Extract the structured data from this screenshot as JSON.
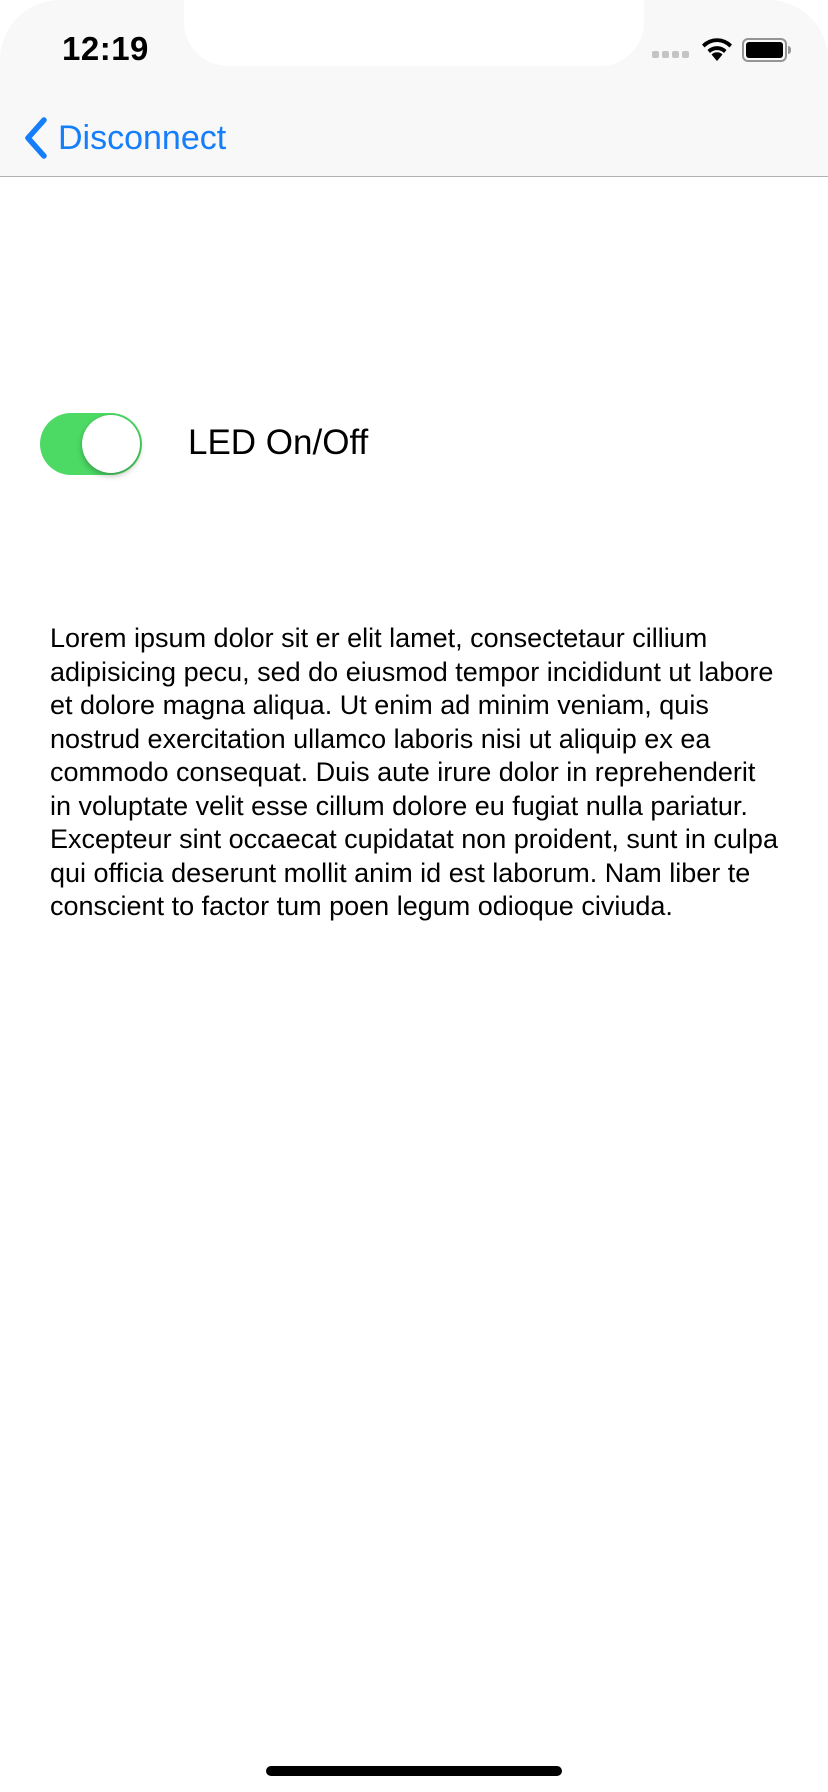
{
  "status_bar": {
    "time": "12:19",
    "icons": [
      "cellular-signal-icon",
      "wifi-icon",
      "battery-icon"
    ]
  },
  "nav_bar": {
    "back_label": "Disconnect",
    "back_icon": "chevron-left-icon"
  },
  "led_toggle": {
    "label": "LED On/Off",
    "state": "on",
    "on_color": "#4cd964"
  },
  "body": {
    "text": "Lorem ipsum dolor sit er elit lamet, consectetaur cillium adipisicing pecu, sed do eiusmod tempor incididunt ut labore et dolore magna aliqua. Ut enim ad minim veniam, quis nostrud exercitation ullamco laboris nisi ut aliquip ex ea commodo consequat. Duis aute irure dolor in reprehenderit in voluptate velit esse cillum dolore eu fugiat nulla pariatur. Excepteur sint occaecat cupidatat non proident, sunt in culpa qui officia deserunt mollit anim id est laborum. Nam liber te conscient to factor tum poen legum odioque civiuda."
  },
  "colors": {
    "accent": "#147efb",
    "bar_background": "#f8f8f8"
  }
}
